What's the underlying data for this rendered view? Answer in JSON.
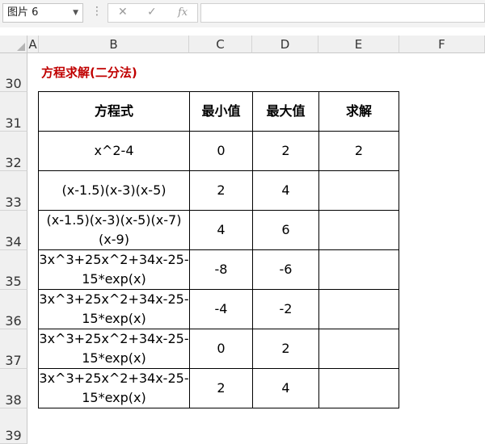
{
  "formula_bar": {
    "name_box": "图片 6",
    "cancel_icon": "✕",
    "enter_icon": "✓",
    "fx_label": "fx",
    "formula": ""
  },
  "columns": [
    "A",
    "B",
    "C",
    "D",
    "E",
    "F"
  ],
  "rows": [
    "30",
    "31",
    "32",
    "33",
    "34",
    "35",
    "36",
    "37",
    "38",
    "39"
  ],
  "title": "方程求解(二分法)",
  "table": {
    "headers": [
      "方程式",
      "最小值",
      "最大值",
      "求解"
    ],
    "rows": [
      {
        "equation": "x^2-4",
        "min": "0",
        "max": "2",
        "solution": "2"
      },
      {
        "equation": "(x-1.5)(x-3)(x-5)",
        "min": "2",
        "max": "4",
        "solution": ""
      },
      {
        "equation": "(x-1.5)(x-3)(x-5)(x-7)(x-9)",
        "min": "4",
        "max": "6",
        "solution": ""
      },
      {
        "equation": "3x^3+25x^2+34x-25-15*exp(x)",
        "min": "-8",
        "max": "-6",
        "solution": ""
      },
      {
        "equation": "3x^3+25x^2+34x-25-15*exp(x)",
        "min": "-4",
        "max": "-2",
        "solution": ""
      },
      {
        "equation": "3x^3+25x^2+34x-25-15*exp(x)",
        "min": "0",
        "max": "2",
        "solution": ""
      },
      {
        "equation": "3x^3+25x^2+34x-25-15*exp(x)",
        "min": "2",
        "max": "4",
        "solution": ""
      }
    ]
  }
}
